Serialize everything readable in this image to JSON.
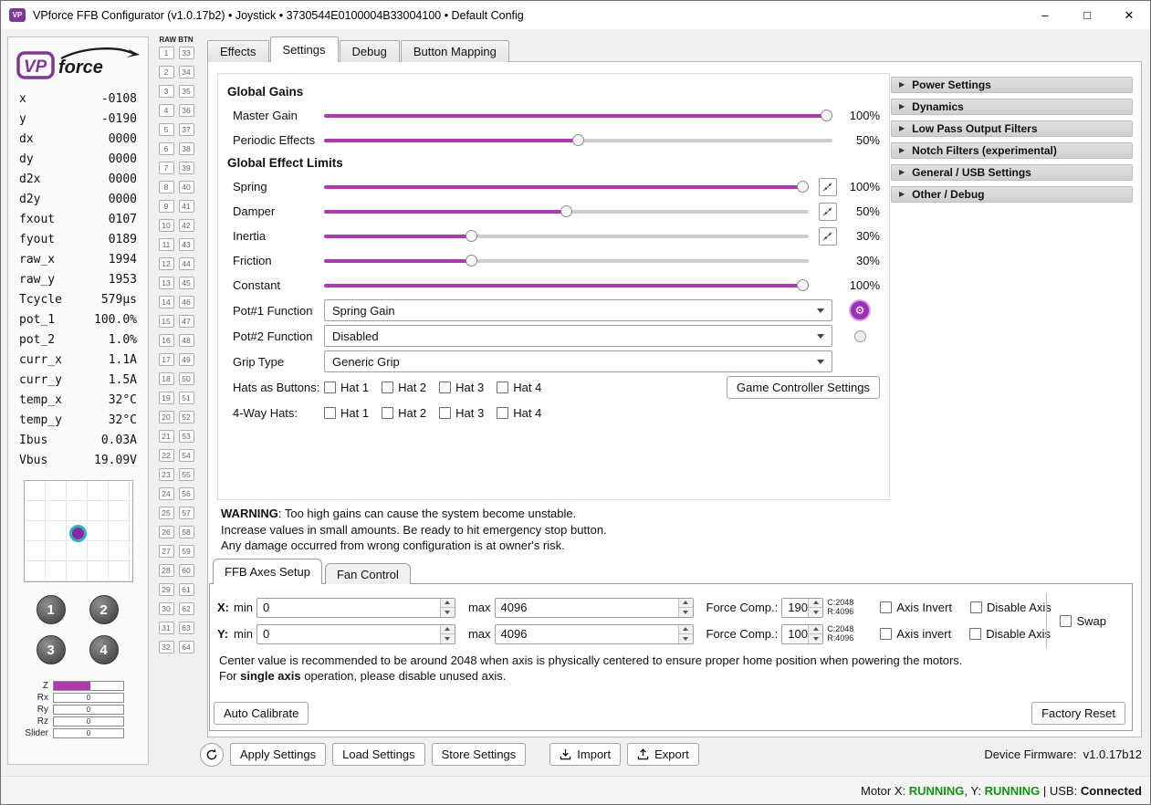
{
  "window": {
    "title": "VPforce FFB Configurator (v1.0.17b2) • Joystick • 3730544E0100004B33004100 • Default Config",
    "controls": {
      "minimize": "–",
      "maximize": "□",
      "close": "✕"
    }
  },
  "sidebar": {
    "logo_vp": "VP",
    "logo_force": "force",
    "telemetry": [
      {
        "label": "x",
        "value": "-0108"
      },
      {
        "label": "y",
        "value": "-0190"
      },
      {
        "label": "dx",
        "value": "0000"
      },
      {
        "label": "dy",
        "value": "0000"
      },
      {
        "label": "d2x",
        "value": "0000"
      },
      {
        "label": "d2y",
        "value": "0000"
      },
      {
        "label": "fxout",
        "value": "0107"
      },
      {
        "label": "fyout",
        "value": "0189"
      },
      {
        "label": "raw_x",
        "value": "1994"
      },
      {
        "label": "raw_y",
        "value": "1953"
      },
      {
        "label": "Tcycle",
        "value": "579µs"
      },
      {
        "label": "pot_1",
        "value": "100.0%"
      },
      {
        "label": "pot_2",
        "value": "1.0%"
      },
      {
        "label": "curr_x",
        "value": "1.1A"
      },
      {
        "label": "curr_y",
        "value": "1.5A"
      },
      {
        "label": "temp_x",
        "value": "32°C"
      },
      {
        "label": "temp_y",
        "value": "32°C"
      },
      {
        "label": "Ibus",
        "value": "0.03A"
      },
      {
        "label": "Vbus",
        "value": "19.09V"
      }
    ],
    "joy_buttons": [
      "1",
      "2",
      "3",
      "4"
    ],
    "axis_bars": [
      {
        "label": "Z",
        "value": "",
        "fill_pct": 52
      },
      {
        "label": "Rx",
        "value": "0",
        "fill_pct": 0
      },
      {
        "label": "Ry",
        "value": "0",
        "fill_pct": 0
      },
      {
        "label": "Rz",
        "value": "0",
        "fill_pct": 0
      },
      {
        "label": "Slider",
        "value": "0",
        "fill_pct": 0
      }
    ]
  },
  "raw_btn": {
    "header": "RAW BTN",
    "pairs": [
      [
        1,
        33
      ],
      [
        2,
        34
      ],
      [
        3,
        35
      ],
      [
        4,
        36
      ],
      [
        5,
        37
      ],
      [
        6,
        38
      ],
      [
        7,
        39
      ],
      [
        8,
        40
      ],
      [
        9,
        41
      ],
      [
        10,
        42
      ],
      [
        11,
        43
      ],
      [
        12,
        44
      ],
      [
        13,
        45
      ],
      [
        14,
        46
      ],
      [
        15,
        47
      ],
      [
        16,
        48
      ],
      [
        17,
        49
      ],
      [
        18,
        50
      ],
      [
        19,
        51
      ],
      [
        20,
        52
      ],
      [
        21,
        53
      ],
      [
        22,
        54
      ],
      [
        23,
        55
      ],
      [
        24,
        56
      ],
      [
        25,
        57
      ],
      [
        26,
        58
      ],
      [
        27,
        59
      ],
      [
        28,
        60
      ],
      [
        29,
        61
      ],
      [
        30,
        62
      ],
      [
        31,
        63
      ],
      [
        32,
        64
      ]
    ]
  },
  "main_tabs": [
    {
      "label": "Effects",
      "active": false
    },
    {
      "label": "Settings",
      "active": true
    },
    {
      "label": "Debug",
      "active": false
    },
    {
      "label": "Button Mapping",
      "active": false
    }
  ],
  "settings": {
    "global_gains": {
      "header": "Global Gains",
      "sliders": [
        {
          "label": "Master Gain",
          "percent": 100,
          "display": "100%"
        },
        {
          "label": "Periodic Effects",
          "percent": 50,
          "display": "50%"
        }
      ]
    },
    "global_effect_limits": {
      "header": "Global Effect Limits",
      "sliders": [
        {
          "label": "Spring",
          "percent": 100,
          "display": "100%",
          "curve": true
        },
        {
          "label": "Damper",
          "percent": 50,
          "display": "50%",
          "curve": true
        },
        {
          "label": "Inertia",
          "percent": 30,
          "display": "30%",
          "curve": true
        },
        {
          "label": "Friction",
          "percent": 30,
          "display": "30%",
          "curve": false
        },
        {
          "label": "Constant",
          "percent": 100,
          "display": "100%",
          "curve": false
        }
      ]
    },
    "selects": [
      {
        "label": "Pot#1 Function",
        "value": "Spring Gain",
        "gear": true
      },
      {
        "label": "Pot#2 Function",
        "value": "Disabled",
        "knob": true
      },
      {
        "label": "Grip Type",
        "value": "Generic Grip"
      }
    ],
    "hat_rows": [
      {
        "label": "Hats as Buttons:",
        "options": [
          "Hat 1",
          "Hat 2",
          "Hat 3",
          "Hat 4"
        ],
        "button": "Game Controller Settings"
      },
      {
        "label": "4-Way Hats:",
        "options": [
          "Hat 1",
          "Hat 2",
          "Hat 3",
          "Hat 4"
        ]
      }
    ]
  },
  "accordion": [
    "Power Settings",
    "Dynamics",
    "Low Pass Output Filters",
    "Notch Filters (experimental)",
    "General / USB Settings",
    "Other / Debug"
  ],
  "warning": {
    "bold": "WARNING",
    "line1": ": Too high gains can cause the system become unstable.",
    "line2": "Increase values in small amounts. Be ready to hit emergency stop button.",
    "line3": "Any damage occurred from wrong configuration is at owner's risk."
  },
  "axes_setup": {
    "tabs": [
      {
        "label": "FFB Axes Setup",
        "active": true
      },
      {
        "label": "Fan Control",
        "active": false
      }
    ],
    "rows": [
      {
        "axis": "X:",
        "key": "x",
        "min_label": "min",
        "min": "0",
        "max_label": "max",
        "max": "4096",
        "fc_label": "Force Comp.:",
        "fc": "190",
        "center": "C:2048",
        "range": "R:4096",
        "invert_label": "Axis Invert",
        "disable_label": "Disable Axis"
      },
      {
        "axis": "Y:",
        "key": "y",
        "min_label": "min",
        "min": "0",
        "max_label": "max",
        "max": "4096",
        "fc_label": "Force Comp.:",
        "fc": "100",
        "center": "C:2048",
        "range": "R:4096",
        "invert_label": "Axis invert",
        "disable_label": "Disable Axis"
      }
    ],
    "swap_label": "Swap",
    "note1": "Center value is recommended to be around 2048 when axis is physically centered to ensure proper home position when powering the motors.",
    "note2_pre": "For ",
    "note2_bold": "single axis",
    "note2_post": " operation, please disable unused axis.",
    "auto_calibrate": "Auto Calibrate",
    "factory_reset": "Factory Reset"
  },
  "toolbar": {
    "apply": "Apply Settings",
    "load": "Load Settings",
    "store": "Store Settings",
    "import": "Import",
    "export": "Export",
    "firmware": "Device Firmware:  v1.0.17b12"
  },
  "statusbar": {
    "motor_prefix": "Motor X: ",
    "motor_x": "RUNNING",
    "sep1": ", Y: ",
    "motor_y": "RUNNING",
    "sep2": " | USB: ",
    "usb": "Connected"
  },
  "colors": {
    "accent": "#aa3cb0",
    "running_green": "#149414",
    "logo_purple": "#7d3a93"
  }
}
